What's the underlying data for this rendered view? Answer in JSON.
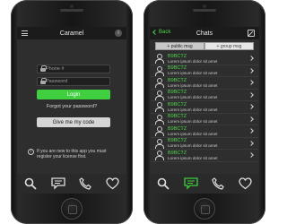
{
  "colors": {
    "accent": "#3fcf3f",
    "background": "#2e2e2e",
    "bar": "#1b1b1b"
  },
  "login_screen": {
    "title": "Caramel",
    "info_glyph": "i",
    "phone_placeholder": "Phone #",
    "password_placeholder": "Password",
    "login_label": "Login",
    "forgot_label": "Forgot your password?",
    "code_label": "Give me my code",
    "notice_glyph": "i",
    "notice_text": "If you are new to this app you must register your license first."
  },
  "chats_screen": {
    "back_label": "Back",
    "title": "Chats",
    "tabs": [
      "+ public msg",
      "+ group msg"
    ],
    "rows": [
      {
        "name": "B9BCTZ",
        "message": "Lorem ipsum dolor sit amet"
      },
      {
        "name": "B9BCTZ",
        "message": "Lorem ipsum dolor sit amet"
      },
      {
        "name": "B9BCTZ",
        "message": "Lorem ipsum dolor sit amet"
      },
      {
        "name": "B9BCTZ",
        "message": "Lorem ipsum dolor sit amet"
      },
      {
        "name": "B9BCTZ",
        "message": "Lorem ipsum dolor sit amet"
      },
      {
        "name": "B9BCTZ",
        "message": "Lorem ipsum dolor sit amet"
      },
      {
        "name": "B9BCTZ",
        "message": "Lorem ipsum dolor sit amet"
      },
      {
        "name": "B9BCTZ",
        "message": "Lorem ipsum dolor sit amet"
      },
      {
        "name": "B9BCTZ",
        "message": "Lorem ipsum dolor sit amet"
      }
    ]
  },
  "tab_bar": {
    "icons": [
      "search-icon",
      "chat-bubble-icon",
      "phone-icon",
      "heart-icon"
    ],
    "active_on_chats": "chat-bubble-icon"
  }
}
